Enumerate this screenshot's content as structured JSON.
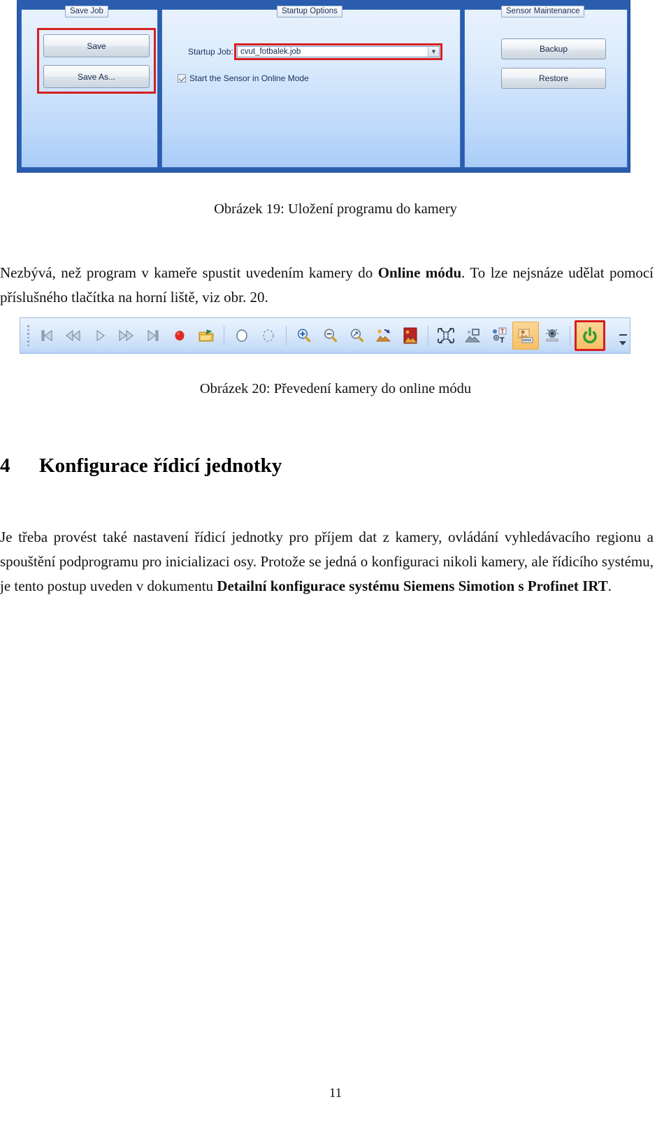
{
  "figure19": {
    "name": "camera-save-job-dialog",
    "groups": [
      {
        "title": "Save Job",
        "buttons": [
          "Save",
          "Save As..."
        ]
      },
      {
        "title": "Startup Options",
        "field_label": "Startup Job:",
        "field_value": "cvut_fotbalek.job",
        "checkbox_label": "Start the Sensor in Online Mode",
        "checkbox_checked": "true"
      },
      {
        "title": "Sensor Maintenance",
        "buttons": [
          "Backup",
          "Restore"
        ]
      }
    ],
    "annotation_color": "#d61f20"
  },
  "captions": {
    "fig19": "Obrázek 19: Uložení programu do kamery",
    "fig20": "Obrázek 20: Převedení kamery do online módu"
  },
  "paragraphs": {
    "p1_before": "Nezbývá, než program v kameře spustit uvedením kamery do ",
    "p1_bold": "Online módu",
    "p1_after": ". To lze nejsnáze udělat pomocí příslušného tlačítka na horní liště, viz obr. 20.",
    "p2_before": "Je třeba provést také nastavení řídicí jednotky pro příjem dat z kamery, ovládání vyhledávacího regionu a spouštění podprogramu pro inicializaci osy. Protože se jedná o konfiguraci nikoli kamery, ale řídicího systému, je tento postup uveden v dokumentu ",
    "p2_bold": "Detailní konfigurace systému Siemens Simotion s Profinet IRT",
    "p2_after": "."
  },
  "section": {
    "number": "4",
    "title": "Konfigurace řídicí jednotky"
  },
  "figure20": {
    "name": "camera-toolbar",
    "highlight_color": "#f7bf66",
    "annotation_color": "#d61f20",
    "icons": [
      "skip-to-start-icon",
      "rewind-icon",
      "play-icon",
      "fast-forward-icon",
      "skip-to-end-icon",
      "record-icon",
      "open-folder-icon",
      "circle-icon",
      "dashed-circle-icon",
      "zoom-in-icon",
      "zoom-out-icon",
      "zoom-fit-icon",
      "image-refresh-icon",
      "image-mask-icon",
      "resize-icon",
      "image-region-icon",
      "text-tool-icon",
      "filmstrip-icon",
      "sensor-icon",
      "power-online-icon"
    ]
  },
  "page_number": "11"
}
